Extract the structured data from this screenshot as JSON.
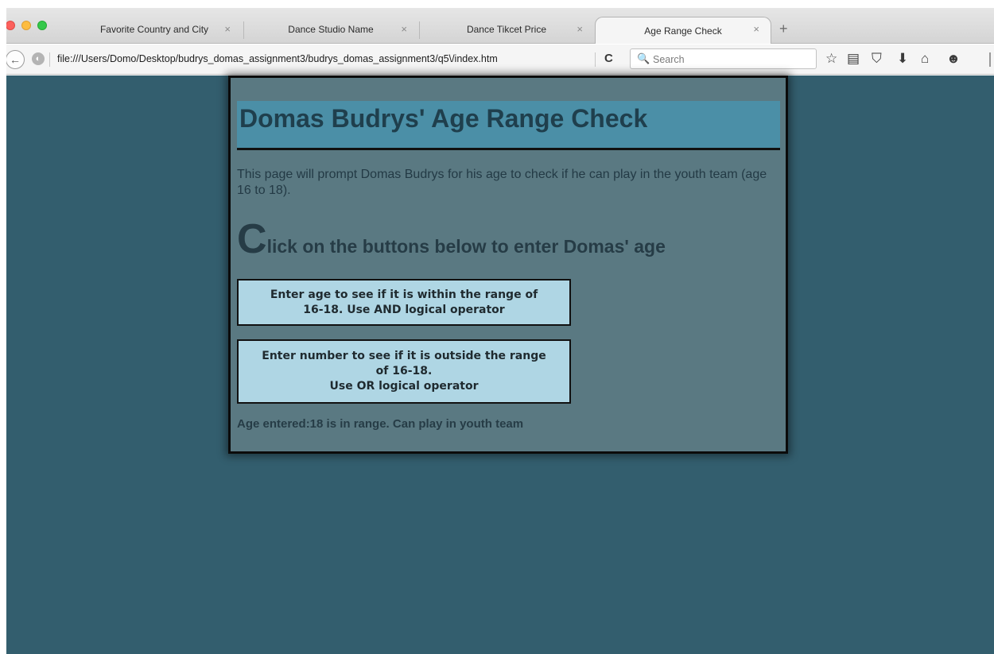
{
  "browser": {
    "tabs": [
      {
        "label": "Favorite Country and City",
        "active": false
      },
      {
        "label": "Dance Studio Name",
        "active": false
      },
      {
        "label": "Dance Tikcet Price",
        "active": false
      },
      {
        "label": "Age Range Check",
        "active": true
      }
    ],
    "close_glyph": "×",
    "new_tab_glyph": "+",
    "url": "file:///Users/Domo/Desktop/budrys_domas_assignment3/budrys_domas_assignment3/q5\\/index.htm",
    "search_placeholder": "Search",
    "icons": {
      "back": "←",
      "site": "◐",
      "reload": "C",
      "search": "🔍",
      "bookmark_star": "☆",
      "reading_list": "▤",
      "pocket": "⛉",
      "download": "⬇",
      "home": "⌂",
      "hello": "☻"
    }
  },
  "page": {
    "title": "Domas Budrys' Age Range Check",
    "intro": "This page will prompt Domas Budrys for his age to check if he can play in the youth team (age 16 to 18).",
    "subhead_initial": "C",
    "subhead_rest": "lick on the buttons below to enter Domas' age",
    "button_and": "Enter age to see if it is within the range of\n16-18. Use AND logical operator",
    "button_or": "Enter number to see if it is outside the range\nof 16-18.\nUse OR logical operator",
    "result": "Age entered:18 is in range. Can play in youth team"
  },
  "colors": {
    "background": "#335e6e",
    "card": "#5a7982",
    "banner": "#4b8fa7",
    "button": "#afd6e4"
  }
}
